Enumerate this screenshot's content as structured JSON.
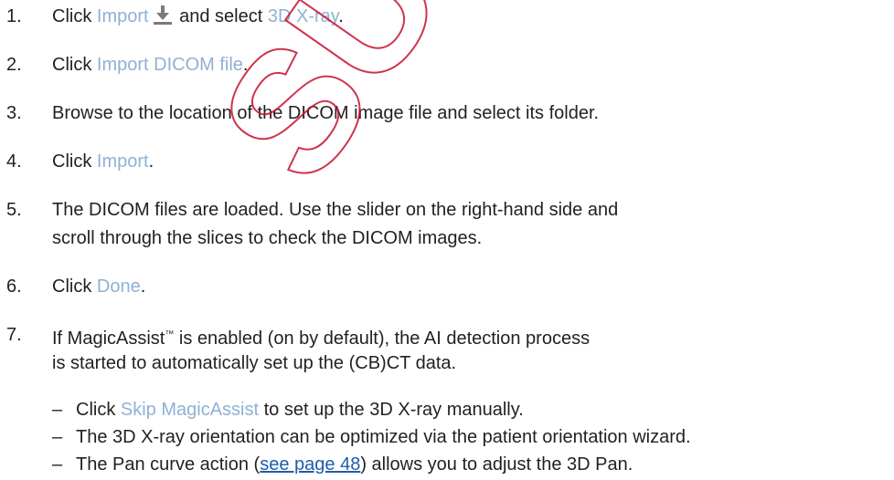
{
  "steps": [
    {
      "number": "1.",
      "pre": "Click ",
      "ui1": "Import",
      "mid": " and select ",
      "ui2": "3D X-ray",
      "post": "."
    },
    {
      "number": "2.",
      "pre": "Click ",
      "ui1": "Import DICOM file",
      "post": "."
    },
    {
      "number": "3.",
      "text": "Browse to the location of the DICOM image file and select its folder."
    },
    {
      "number": "4.",
      "pre": "Click ",
      "ui1": "Import",
      "post": "."
    },
    {
      "number": "5.",
      "line1": "The DICOM files are loaded. Use the slider on the right-hand side and",
      "line2": "scroll through the slices to check the DICOM images."
    },
    {
      "number": "6.",
      "pre": "Click ",
      "ui1": "Done",
      "post": "."
    },
    {
      "number": "7.",
      "line1_pre": "If MagicAssist",
      "trademark": "™",
      "line1_post": " is enabled (on by default), the AI detection process",
      "line2": "is started to automatically set up the (CB)CT data."
    }
  ],
  "sub_items": [
    {
      "dash": "–",
      "pre": "Click ",
      "ui1": "Skip MagicAssist",
      "post": " to set up the 3D X-ray manually."
    },
    {
      "dash": "–",
      "text": "The 3D X-ray orientation can be optimized via the patient orientation wizard."
    },
    {
      "dash": "–",
      "pre": "The Pan curve action (",
      "link": "see page 48",
      "post": ") allows you to adjust the 3D Pan."
    }
  ],
  "watermark_text": "SUBJ",
  "colors": {
    "text": "#231f20",
    "ui_highlight": "#8fb1d3",
    "link": "#1f5da8",
    "icon": "#7a7a7a",
    "watermark": "#c8102e"
  },
  "icons": {
    "import": "download-arrow-icon"
  }
}
